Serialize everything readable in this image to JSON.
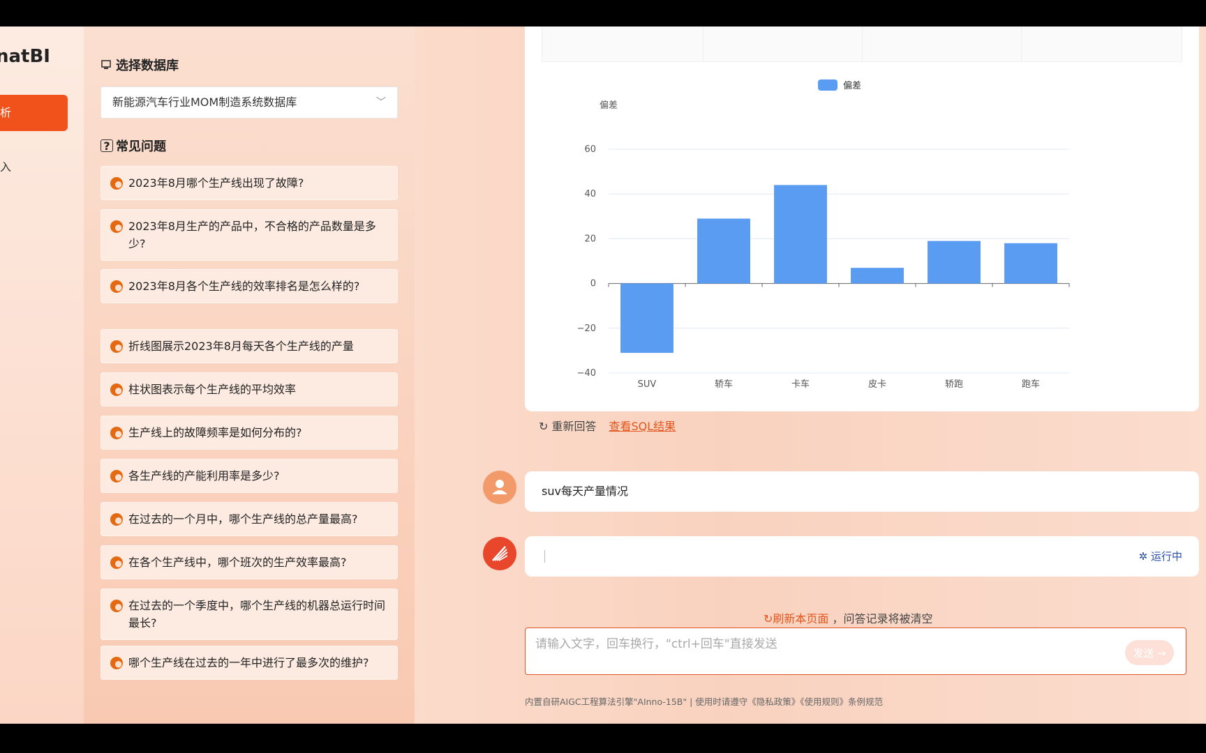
{
  "nav": {
    "brand": "natBI",
    "active_item": "析",
    "item2": "入"
  },
  "panel": {
    "db_title": "选择数据库",
    "db_selected": "新能源汽车行业MOM制造系统数据库",
    "faq_title": "常见问题",
    "questions": [
      "2023年8月哪个生产线出现了故障?",
      "2023年8月生产的产品中，不合格的产品数量是多少?",
      "2023年8月各个生产线的效率排名是怎么样的?",
      "折线图展示2023年8月每天各个生产线的产量",
      "柱状图表示每个生产线的平均效率",
      "生产线上的故障频率是如何分布的?",
      "各生产线的产能利用率是多少?",
      "在过去的一个月中，哪个生产线的总产量最高?",
      "在各个生产线中，哪个班次的生产效率最高?",
      "在过去的一个季度中，哪个生产线的机器总运行时间最长?",
      "哪个生产线在过去的一年中进行了最多次的维护?"
    ]
  },
  "chart_data": {
    "type": "bar",
    "legend": [
      "偏差"
    ],
    "ylabel": "偏差",
    "categories": [
      "SUV",
      "轿车",
      "卡车",
      "皮卡",
      "轿跑",
      "跑车"
    ],
    "series": [
      {
        "name": "偏差",
        "values": [
          -31,
          29,
          44,
          7,
          19,
          18
        ],
        "color": "#5a9cf2"
      }
    ],
    "ylim": [
      -40,
      60
    ],
    "yticks": [
      60,
      40,
      20,
      0,
      -20,
      -40
    ],
    "grid": true,
    "legend_position": "top"
  },
  "actions": {
    "regen": "重新回答",
    "sql": "查看SQL结果"
  },
  "chat": {
    "user_message": "suv每天产量情况",
    "bot_status": "运行中",
    "refresh_link": "刷新本页面",
    "refresh_text": "，问答记录将被清空",
    "input_placeholder": "请输入文字，回车换行，\"ctrl+回车\"直接发送",
    "send_label": "发送 →",
    "footer": "内置自研AIGC工程算法引擎\"AInno-15B\"  |  使用时请遵守《隐私政策》《使用规则》条例规范"
  }
}
